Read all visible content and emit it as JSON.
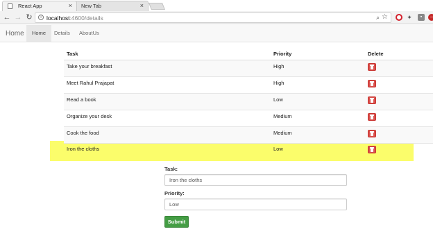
{
  "browser": {
    "tabs": [
      {
        "label": "React App",
        "active": true
      },
      {
        "label": "New Tab",
        "active": false
      }
    ],
    "url_host": "localhost",
    "url_path": ":4600/details",
    "icons": [
      "back-arrow-icon",
      "forward-arrow-icon",
      "reload-icon",
      "info-icon",
      "zoom-icon",
      "star-icon",
      "opera-icon",
      "extension-icon"
    ]
  },
  "navbar": {
    "brand": "Home",
    "items": [
      {
        "label": "Home",
        "active": true
      },
      {
        "label": "Details",
        "active": false
      },
      {
        "label": "AboutUs",
        "active": false
      }
    ]
  },
  "table": {
    "headers": {
      "task": "Task",
      "priority": "Priority",
      "delete": "Delete"
    },
    "rows": [
      {
        "task": "Take your breakfast",
        "priority": "High"
      },
      {
        "task": "Meet Rahul Prajapat",
        "priority": "High"
      },
      {
        "task": "Read a book",
        "priority": "Low"
      },
      {
        "task": "Organize your desk",
        "priority": "Medium"
      },
      {
        "task": "Cook the food",
        "priority": "Medium"
      },
      {
        "task": "Iron the cloths",
        "priority": "Low"
      }
    ],
    "highlight_color": "#fbfd6b",
    "delete_color": "#d9534f"
  },
  "form": {
    "task_label": "Task:",
    "task_value": "Iron the cloths",
    "priority_label": "Priority:",
    "priority_value": "Low",
    "submit_label": "Submit",
    "submit_color": "#449d44"
  }
}
